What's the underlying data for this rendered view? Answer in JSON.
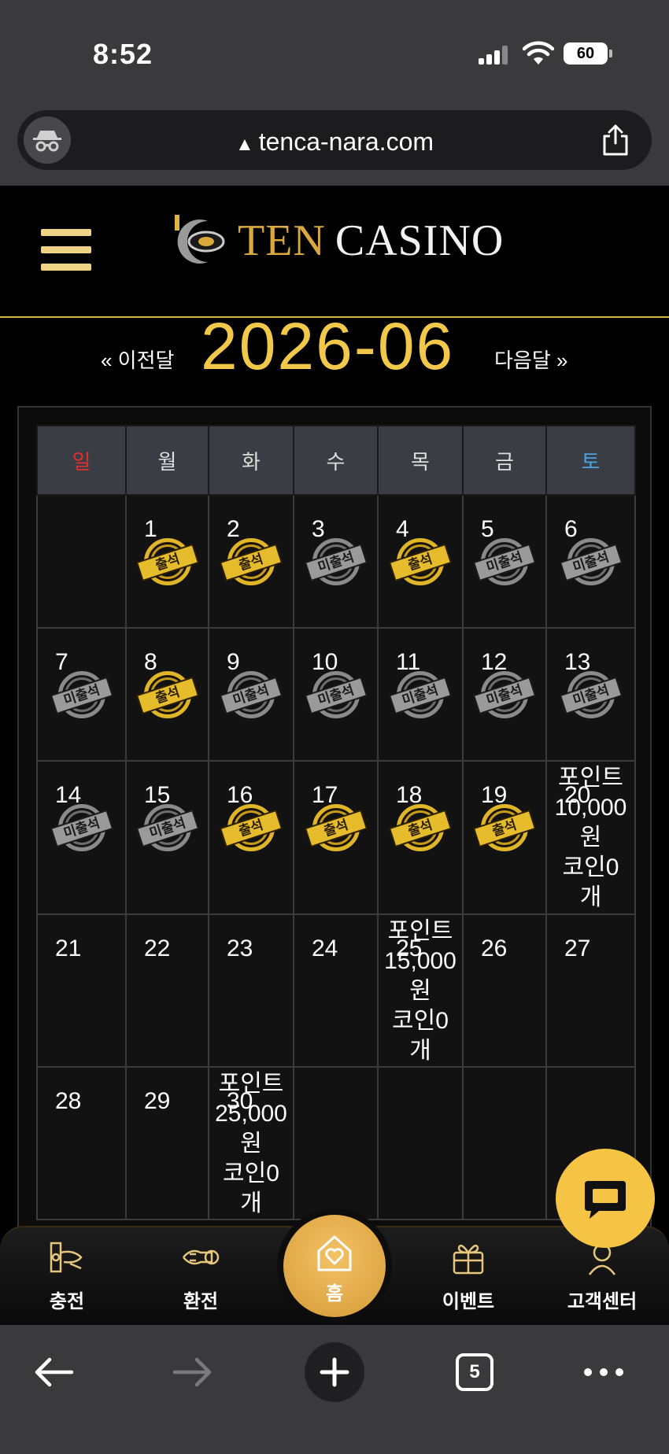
{
  "status_bar": {
    "time": "8:52",
    "battery": "60"
  },
  "browser": {
    "url": "tenca-nara.com",
    "tab_count": "5"
  },
  "site": {
    "logo_ten": "TEN",
    "logo_casino": "CASINO"
  },
  "month_nav": {
    "prev_label": "« 이전달",
    "next_label": "다음달 »",
    "title": "2026-06"
  },
  "weekdays": [
    "일",
    "월",
    "화",
    "수",
    "목",
    "금",
    "토"
  ],
  "stamps": {
    "attended": "출석",
    "absent": "미출석"
  },
  "days": {
    "d1": "1",
    "d2": "2",
    "d3": "3",
    "d4": "4",
    "d5": "5",
    "d6": "6",
    "d7": "7",
    "d8": "8",
    "d9": "9",
    "d10": "10",
    "d11": "11",
    "d12": "12",
    "d13": "13",
    "d14": "14",
    "d15": "15",
    "d16": "16",
    "d17": "17",
    "d18": "18",
    "d19": "19",
    "d20": "20",
    "d21": "21",
    "d22": "22",
    "d23": "23",
    "d24": "24",
    "d25": "25",
    "d26": "26",
    "d27": "27",
    "d28": "28",
    "d29": "29",
    "d30": "30"
  },
  "rewards": {
    "d20": {
      "line1": "포인트",
      "line2": "10,000",
      "line3": "원",
      "line4": "코인0",
      "line5": "개"
    },
    "d25": {
      "line1": "포인트",
      "line2": "15,000",
      "line3": "원",
      "line4": "코인0",
      "line5": "개"
    },
    "d30": {
      "line1": "포인트",
      "line2": "25,000",
      "line3": "원",
      "line4": "코인0",
      "line5": "개"
    }
  },
  "bottom_nav": {
    "deposit": "충전",
    "withdraw": "환전",
    "home": "홈",
    "event": "이벤트",
    "support": "고객센터"
  },
  "colors": {
    "gold": "#f2c84b",
    "sunday": "#e03030",
    "saturday": "#4aa3df",
    "chat": "#f5c445"
  }
}
